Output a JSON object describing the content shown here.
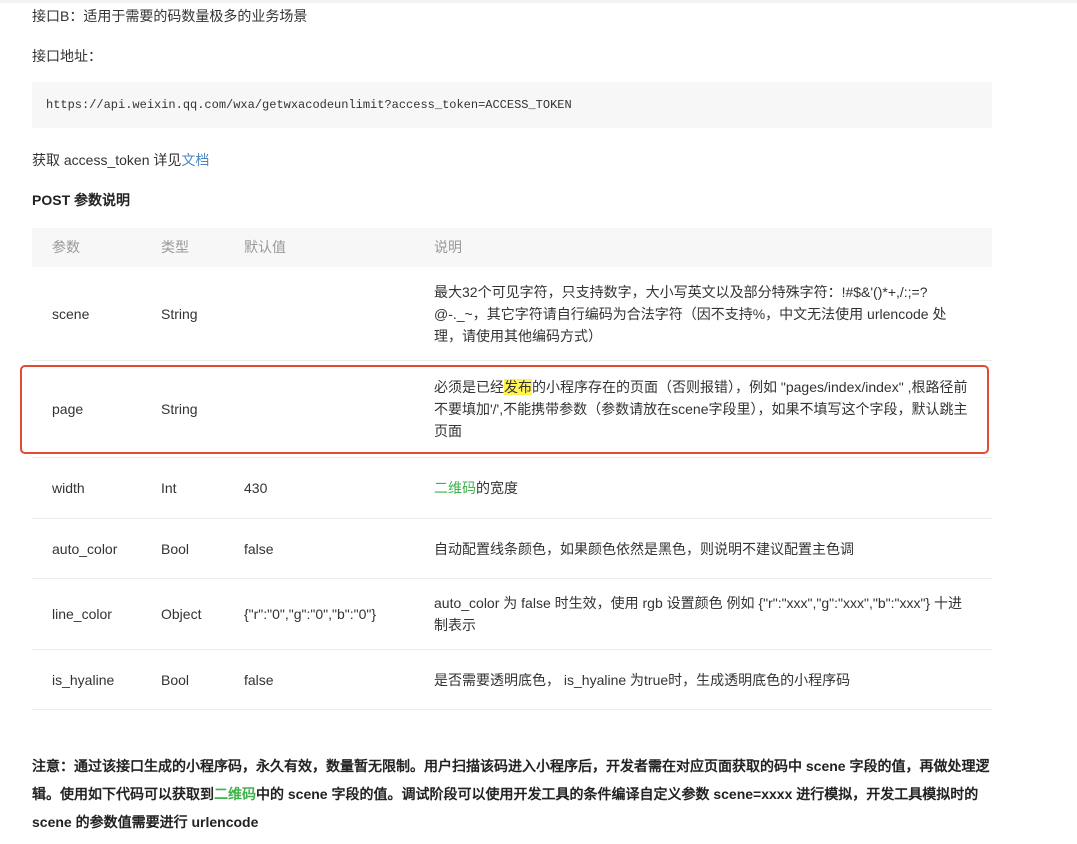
{
  "intro": {
    "title_line": "接口B：适用于需要的码数量极多的业务场景",
    "address_label": "接口地址：",
    "url": "https://api.weixin.qq.com/wxa/getwxacodeunlimit?access_token=ACCESS_TOKEN",
    "token_prefix": "获取 access_token 详见",
    "token_link": "文档"
  },
  "section_title": "POST 参数说明",
  "table": {
    "headers": [
      "参数",
      "类型",
      "默认值",
      "说明"
    ],
    "rows": [
      {
        "param": "scene",
        "type": "String",
        "default": "",
        "desc": "最大32个可见字符，只支持数字，大小写英文以及部分特殊字符：!#$&'()*+,/:;=?@-._~，其它字符请自行编码为合法字符（因不支持%，中文无法使用 urlencode 处理，请使用其他编码方式）"
      },
      {
        "param": "page",
        "type": "String",
        "default": "",
        "desc_pre": "必须是已经",
        "desc_hl": "发布",
        "desc_post": "的小程序存在的页面（否则报错），例如 \"pages/index/index\" ,根路径前不要填加'/',不能携带参数（参数请放在scene字段里），如果不填写这个字段，默认跳主页面"
      },
      {
        "param": "width",
        "type": "Int",
        "default": "430",
        "desc_link": "二维码",
        "desc_post": "的宽度"
      },
      {
        "param": "auto_color",
        "type": "Bool",
        "default": "false",
        "desc": "自动配置线条颜色，如果颜色依然是黑色，则说明不建议配置主色调"
      },
      {
        "param": "line_color",
        "type": "Object",
        "default": "{\"r\":\"0\",\"g\":\"0\",\"b\":\"0\"}",
        "desc": "auto_color 为 false 时生效，使用 rgb 设置颜色 例如 {\"r\":\"xxx\",\"g\":\"xxx\",\"b\":\"xxx\"} 十进制表示"
      },
      {
        "param": "is_hyaline",
        "type": "Bool",
        "default": "false",
        "desc": "是否需要透明底色， is_hyaline 为true时，生成透明底色的小程序码"
      }
    ]
  },
  "note": {
    "part1": "注意：通过该接口生成的小程序码，永久有效，数量暂无限制。用户扫描该码进入小程序后，开发者需在对应页面获取的码中 scene 字段的值，再做处理逻辑。使用如下代码可以获取到",
    "link": "二维码",
    "part2": "中的 scene 字段的值。调试阶段可以使用开发工具的条件编译自定义参数 scene=xxxx 进行模拟，开发工具模拟时的 scene 的参数值需要进行 urlencode"
  },
  "colors": {
    "link_blue": "#4a86c5",
    "link_green": "#3fb24a",
    "highlight_box": "#e24b31",
    "highlight_text_bg": "#fff44f"
  }
}
